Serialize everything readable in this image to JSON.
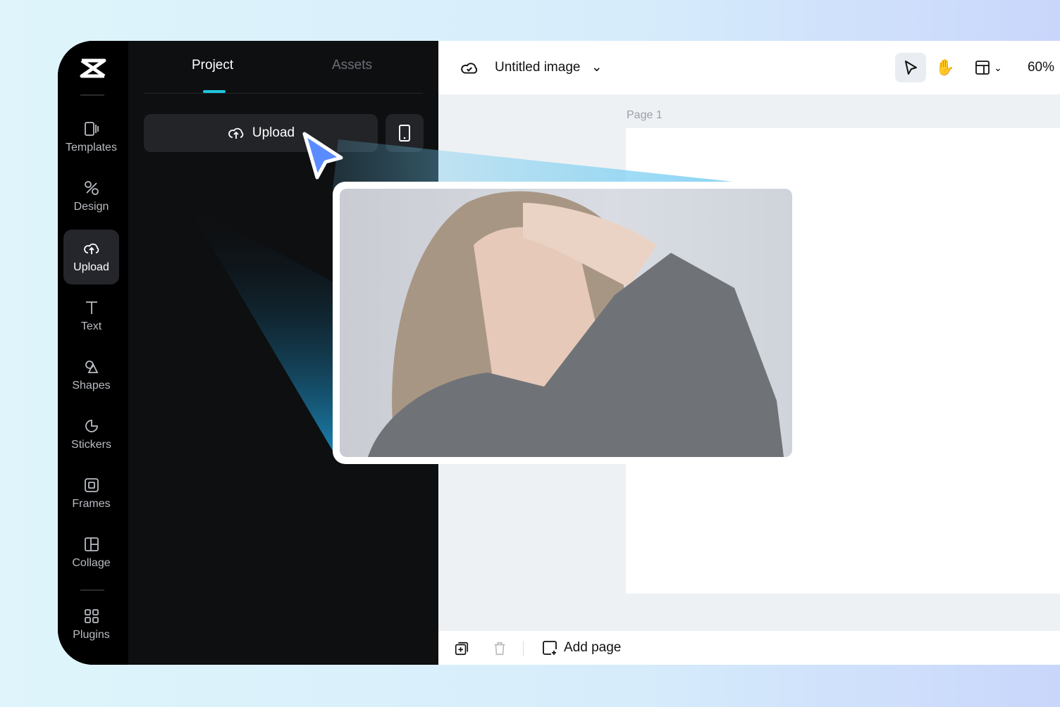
{
  "sidebar": {
    "items": [
      {
        "label": "Templates",
        "icon": "templates-icon"
      },
      {
        "label": "Design",
        "icon": "design-icon"
      },
      {
        "label": "Upload",
        "icon": "cloud-upload-icon",
        "active": true
      },
      {
        "label": "Text",
        "icon": "text-icon"
      },
      {
        "label": "Shapes",
        "icon": "shapes-icon"
      },
      {
        "label": "Stickers",
        "icon": "sticker-icon"
      },
      {
        "label": "Frames",
        "icon": "frame-icon"
      },
      {
        "label": "Collage",
        "icon": "collage-icon"
      },
      {
        "label": "Plugins",
        "icon": "plugins-icon"
      }
    ]
  },
  "panel": {
    "tabs": [
      {
        "label": "Project",
        "active": true
      },
      {
        "label": "Assets"
      }
    ],
    "upload_label": "Upload"
  },
  "toolbar": {
    "title": "Untitled image",
    "zoom": "60%"
  },
  "canvas": {
    "page_label": "Page 1"
  },
  "bottom": {
    "add_page": "Add page"
  },
  "colors": {
    "accent": "#1fc6e0",
    "cursor": "#5b8cff"
  }
}
